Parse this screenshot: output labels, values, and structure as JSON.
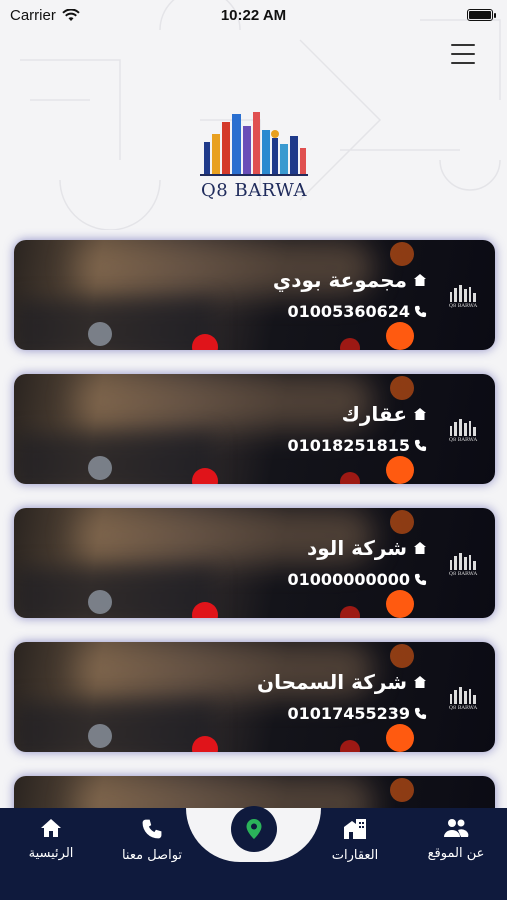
{
  "status_bar": {
    "carrier": "Carrier",
    "time": "10:22 AM"
  },
  "logo": {
    "text": "Q8 BARWA"
  },
  "companies": [
    {
      "name": "مجموعة بودي",
      "phone": "01005360624"
    },
    {
      "name": "عقارك",
      "phone": "01018251815"
    },
    {
      "name": "شركة الود",
      "phone": "01000000000"
    },
    {
      "name": "شركة السمحان",
      "phone": "01017455239"
    }
  ],
  "card_logo_text": "Q8 BARWA",
  "bottom_nav": {
    "home": "الرئيسية",
    "contact": "تواصل معنا",
    "properties": "العقارات",
    "about": "عن الموقع"
  },
  "icons": {
    "menu": "hamburger-icon",
    "home": "home-icon",
    "phone": "phone-icon",
    "location": "location-pin-icon",
    "properties": "buildings-icon",
    "about": "people-icon"
  },
  "colors": {
    "nav_background": "#0f1a3d",
    "location_pin": "#2bb35a",
    "brand_text": "#1f2b5c"
  }
}
